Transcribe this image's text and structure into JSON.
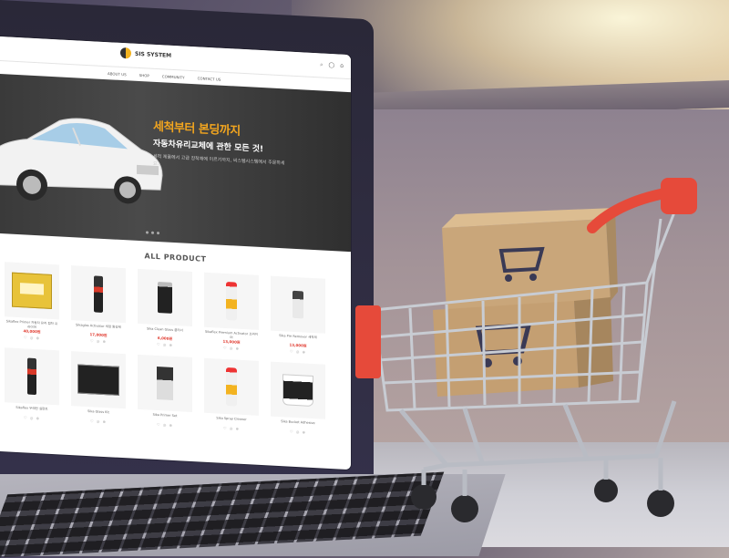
{
  "scene": {
    "description_free": true
  },
  "site": {
    "logo_text": "SIS SYSTEM",
    "nav": [
      "ABOUT US",
      "SHOP",
      "COMMUNITY",
      "CONTACT US"
    ],
    "header_icons": [
      "search-icon",
      "user-icon",
      "cart-icon"
    ]
  },
  "hero": {
    "title": "세척부터 본딩까지",
    "subtitle": "자동차유리교체에 관한 모든 것!",
    "description": "세척 제품에서 고급 장착재에 이르기까지, 씨스템시스템에서 주문하세요."
  },
  "products": {
    "section_title": "ALL PRODUCT",
    "items": [
      {
        "name": "Sikaflex Primer 자동차 유리 접착 프라이머",
        "price": "40,000원",
        "shape": "box"
      },
      {
        "name": "Sikaglas Activator 세정 활성제",
        "price": "17,000원",
        "shape": "tube"
      },
      {
        "name": "Sika Clean Glass 클리너",
        "price": "6,000원",
        "shape": "can"
      },
      {
        "name": "Sikaflex Premium Activator 프라이머",
        "price": "13,000원",
        "shape": "spray"
      },
      {
        "name": "Sika Pre Remover 세척제",
        "price": "13,000원",
        "shape": "small"
      },
      {
        "name": "Sikaflex 우레탄 실런트",
        "price": "",
        "shape": "tube"
      },
      {
        "name": "Sika Glass Kit",
        "price": "",
        "shape": "kit"
      },
      {
        "name": "Sika Primer Set",
        "price": "",
        "shape": "kit2"
      },
      {
        "name": "Sika Spray Cleaner",
        "price": "",
        "shape": "spray"
      },
      {
        "name": "Sika Bucket Adhesive",
        "price": "",
        "shape": "bucket"
      }
    ],
    "item_icons": "♡ ◎ ⊕"
  },
  "colors": {
    "accent": "#f2a51f",
    "price": "#e03a2f",
    "cart_handle": "#e64a3a"
  }
}
